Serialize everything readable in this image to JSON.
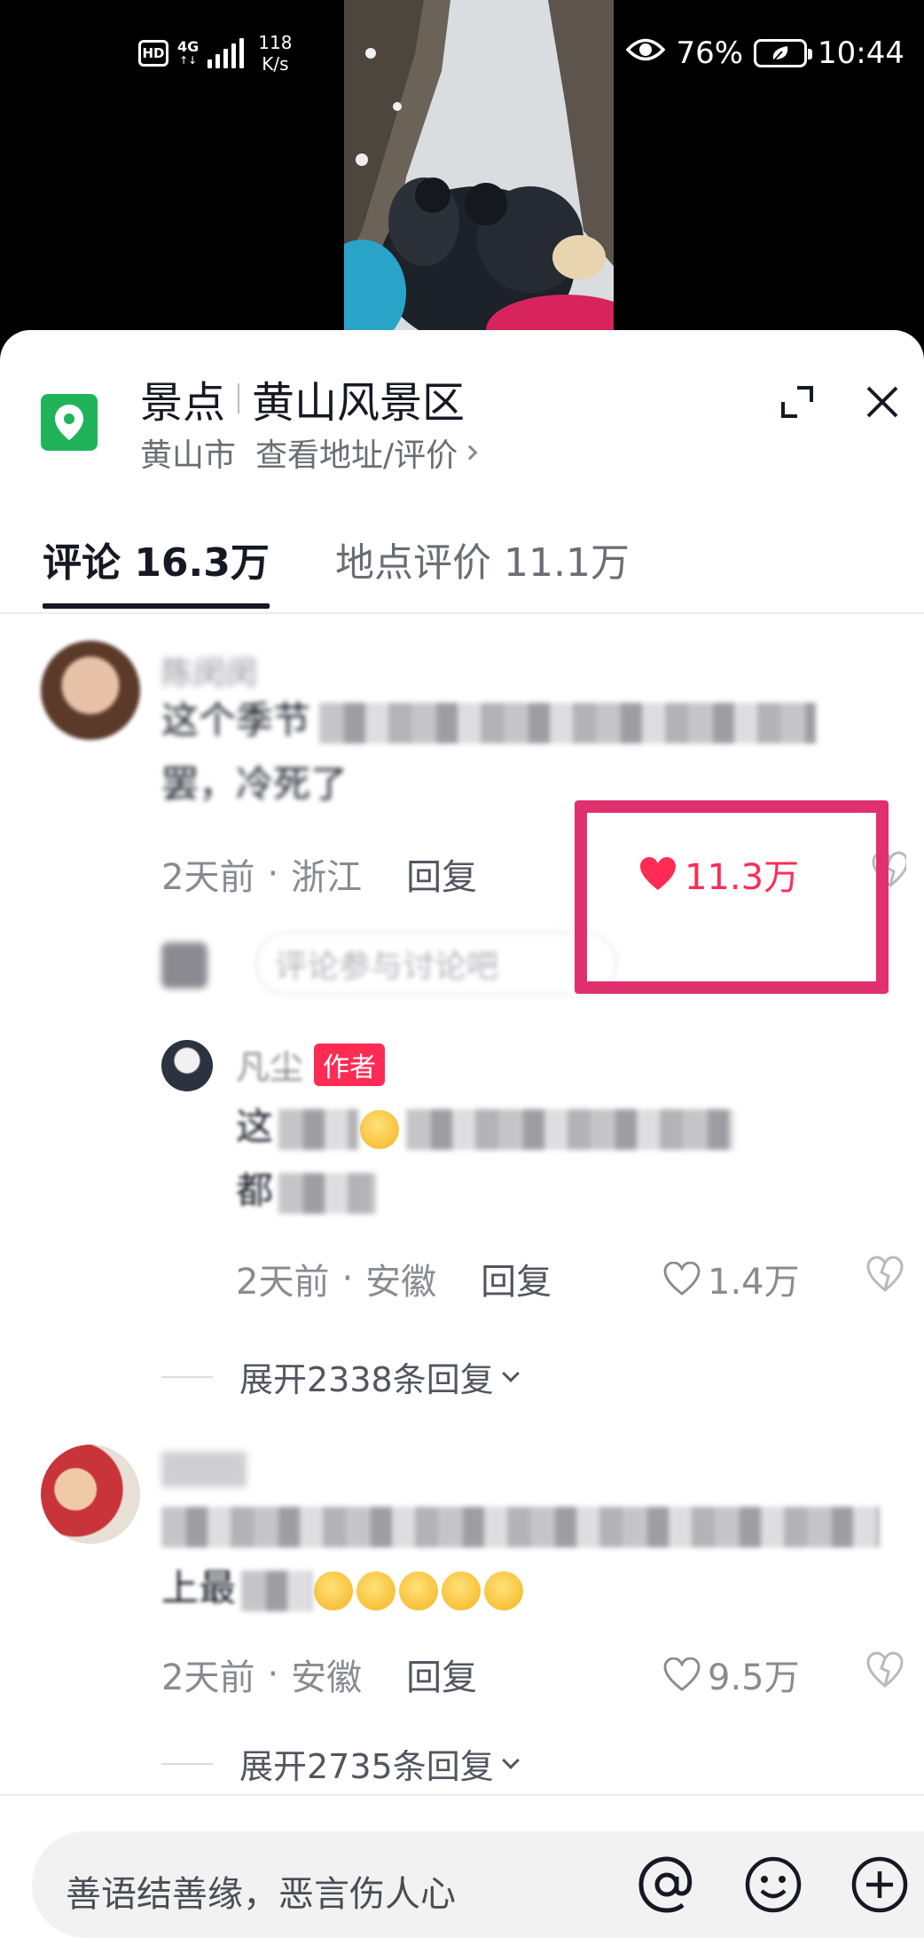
{
  "status_bar": {
    "hd": "HD",
    "network": "4G",
    "speed_value": "118",
    "speed_unit": "K/s",
    "battery_percent": "76%",
    "time": "10:44"
  },
  "place": {
    "category": "景点",
    "name": "黄山风景区",
    "city": "黄山市",
    "address_link": "查看地址/评价"
  },
  "tabs": [
    {
      "label": "评论 16.3万",
      "active": true
    },
    {
      "label": "地点评价 11.1万",
      "active": false
    }
  ],
  "comments": [
    {
      "username": "陈闵闵",
      "text_line1": "这个季节",
      "text_line2": "罢，冷死了",
      "time": "2天前",
      "region": "浙江",
      "reply_label": "回复",
      "likes": "11.3万",
      "liked": true,
      "reply_prompt": "评论参与讨论吧",
      "replies": [
        {
          "username": "凡尘",
          "badge": "作者",
          "text_line1": "这",
          "text_line2": "都",
          "time": "2天前",
          "region": "安徽",
          "reply_label": "回复",
          "likes": "1.4万"
        }
      ],
      "expand_label": "展开2338条回复"
    },
    {
      "username": "",
      "text_line1": "",
      "text_line2": "上最",
      "time": "2天前",
      "region": "安徽",
      "reply_label": "回复",
      "likes": "9.5万",
      "liked": false,
      "expand_label": "展开2735条回复"
    }
  ],
  "meta_separator": "·",
  "input": {
    "placeholder": "善语结善缘，恶言伤人心"
  },
  "icons": [
    "location-pin-icon",
    "expand-icon",
    "close-icon",
    "heart-icon",
    "dislike-icon",
    "at-icon",
    "emoji-icon",
    "add-icon",
    "eye-icon"
  ],
  "colors": {
    "accent": "#fe2c55",
    "highlight": "#e0306e",
    "pin": "#21b35a"
  }
}
